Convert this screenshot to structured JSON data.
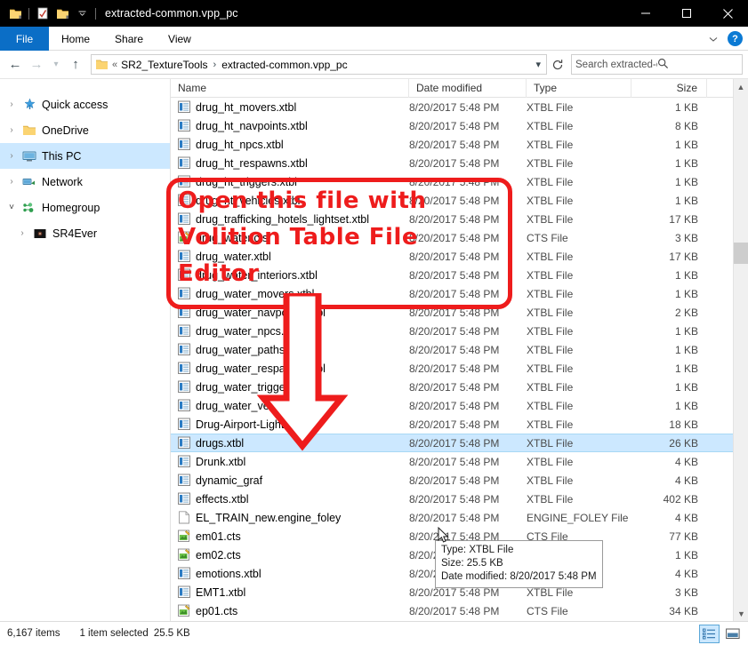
{
  "window": {
    "title": "extracted-common.vpp_pc",
    "quick_access_icons": [
      "folder-icon",
      "properties-icon",
      "new-folder-icon",
      "customize-chevron-icon"
    ],
    "controls": {
      "minimize": "minimize-icon",
      "maximize": "maximize-icon",
      "close": "close-icon"
    }
  },
  "ribbon": {
    "tabs": [
      {
        "label": "File",
        "active": true
      },
      {
        "label": "Home",
        "active": false
      },
      {
        "label": "Share",
        "active": false
      },
      {
        "label": "View",
        "active": false
      }
    ],
    "collapse_icon": "chevron-down-icon",
    "help_label": "?"
  },
  "address": {
    "back_icon": "back-arrow-icon",
    "forward_icon": "forward-arrow-icon",
    "recent_icon": "chevron-down-icon",
    "up_icon": "up-arrow-icon",
    "folder_icon": "folder-icon",
    "crumb_overflow": "«",
    "crumbs": [
      "SR2_TextureTools",
      "extracted-common.vpp_pc"
    ],
    "dropdown_icon": "chevron-down-icon",
    "refresh_icon": "refresh-icon",
    "search_placeholder": "Search extracted-common.v...",
    "search_value": "",
    "search_icon": "search-icon"
  },
  "navpane": {
    "items": [
      {
        "label": "Quick access",
        "icon": "star-pin-icon",
        "chevron": "›",
        "expanded": false,
        "selected": false,
        "indent": 0
      },
      {
        "label": "OneDrive",
        "icon": "onedrive-folder-icon",
        "chevron": "›",
        "expanded": false,
        "selected": false,
        "indent": 0
      },
      {
        "label": "This PC",
        "icon": "monitor-icon",
        "chevron": "›",
        "expanded": false,
        "selected": true,
        "indent": 0
      },
      {
        "label": "Network",
        "icon": "network-icon",
        "chevron": "›",
        "expanded": false,
        "selected": false,
        "indent": 0
      },
      {
        "label": "Homegroup",
        "icon": "homegroup-icon",
        "chevron": "˅",
        "expanded": true,
        "selected": false,
        "indent": 0
      },
      {
        "label": "SR4Ever",
        "icon": "computer-avatar-icon",
        "chevron": "›",
        "expanded": false,
        "selected": false,
        "indent": 1
      }
    ]
  },
  "filelist": {
    "columns": [
      "Name",
      "Date modified",
      "Type",
      "Size"
    ],
    "sort_indicator": "ascending-caret-icon",
    "rows": [
      {
        "name": "drug_ht_movers.xtbl",
        "date": "8/20/2017 5:48 PM",
        "type": "XTBL File",
        "size": "1 KB",
        "icon": "xtbl-file-icon",
        "selected": false
      },
      {
        "name": "drug_ht_navpoints.xtbl",
        "date": "8/20/2017 5:48 PM",
        "type": "XTBL File",
        "size": "8 KB",
        "icon": "xtbl-file-icon",
        "selected": false
      },
      {
        "name": "drug_ht_npcs.xtbl",
        "date": "8/20/2017 5:48 PM",
        "type": "XTBL File",
        "size": "1 KB",
        "icon": "xtbl-file-icon",
        "selected": false
      },
      {
        "name": "drug_ht_respawns.xtbl",
        "date": "8/20/2017 5:48 PM",
        "type": "XTBL File",
        "size": "1 KB",
        "icon": "xtbl-file-icon",
        "selected": false
      },
      {
        "name": "drug_ht_triggers.xtbl",
        "date": "8/20/2017 5:48 PM",
        "type": "XTBL File",
        "size": "1 KB",
        "icon": "xtbl-file-icon",
        "selected": false
      },
      {
        "name": "drug_ht_vehicles.xtbl",
        "date": "8/20/2017 5:48 PM",
        "type": "XTBL File",
        "size": "1 KB",
        "icon": "xtbl-file-icon",
        "selected": false
      },
      {
        "name": "drug_trafficking_hotels_lightset.xtbl",
        "date": "8/20/2017 5:48 PM",
        "type": "XTBL File",
        "size": "17 KB",
        "icon": "xtbl-file-icon",
        "selected": false
      },
      {
        "name": "drug_water.cts",
        "date": "8/20/2017 5:48 PM",
        "type": "CTS File",
        "size": "3 KB",
        "icon": "cts-file-icon",
        "selected": false
      },
      {
        "name": "drug_water.xtbl",
        "date": "8/20/2017 5:48 PM",
        "type": "XTBL File",
        "size": "17 KB",
        "icon": "xtbl-file-icon",
        "selected": false
      },
      {
        "name": "drug_water_interiors.xtbl",
        "date": "8/20/2017 5:48 PM",
        "type": "XTBL File",
        "size": "1 KB",
        "icon": "xtbl-file-icon",
        "selected": false
      },
      {
        "name": "drug_water_movers.xtbl",
        "date": "8/20/2017 5:48 PM",
        "type": "XTBL File",
        "size": "1 KB",
        "icon": "xtbl-file-icon",
        "selected": false
      },
      {
        "name": "drug_water_navpoints.xtbl",
        "date": "8/20/2017 5:48 PM",
        "type": "XTBL File",
        "size": "2 KB",
        "icon": "xtbl-file-icon",
        "selected": false
      },
      {
        "name": "drug_water_npcs.xtbl",
        "date": "8/20/2017 5:48 PM",
        "type": "XTBL File",
        "size": "1 KB",
        "icon": "xtbl-file-icon",
        "selected": false
      },
      {
        "name": "drug_water_paths.xtbl",
        "date": "8/20/2017 5:48 PM",
        "type": "XTBL File",
        "size": "1 KB",
        "icon": "xtbl-file-icon",
        "selected": false
      },
      {
        "name": "drug_water_respawns.xtbl",
        "date": "8/20/2017 5:48 PM",
        "type": "XTBL File",
        "size": "1 KB",
        "icon": "xtbl-file-icon",
        "selected": false
      },
      {
        "name": "drug_water_triggers.xtbl",
        "date": "8/20/2017 5:48 PM",
        "type": "XTBL File",
        "size": "1 KB",
        "icon": "xtbl-file-icon",
        "selected": false
      },
      {
        "name": "drug_water_vehicles.xtbl",
        "date": "8/20/2017 5:48 PM",
        "type": "XTBL File",
        "size": "1 KB",
        "icon": "xtbl-file-icon",
        "selected": false
      },
      {
        "name": "Drug-Airport-Lightset.xtbl",
        "date": "8/20/2017 5:48 PM",
        "type": "XTBL File",
        "size": "18 KB",
        "icon": "xtbl-file-icon",
        "selected": false
      },
      {
        "name": "drugs.xtbl",
        "date": "8/20/2017 5:48 PM",
        "type": "XTBL File",
        "size": "26 KB",
        "icon": "xtbl-file-icon",
        "selected": true
      },
      {
        "name": "Drunk.xtbl",
        "date": "8/20/2017 5:48 PM",
        "type": "XTBL File",
        "size": "4 KB",
        "icon": "xtbl-file-icon",
        "selected": false
      },
      {
        "name": "dynamic_graf",
        "date": "8/20/2017 5:48 PM",
        "type": "XTBL File",
        "size": "4 KB",
        "icon": "xtbl-file-icon",
        "selected": false
      },
      {
        "name": "effects.xtbl",
        "date": "8/20/2017 5:48 PM",
        "type": "XTBL File",
        "size": "402 KB",
        "icon": "xtbl-file-icon",
        "selected": false
      },
      {
        "name": "EL_TRAIN_new.engine_foley",
        "date": "8/20/2017 5:48 PM",
        "type": "ENGINE_FOLEY File",
        "size": "4 KB",
        "icon": "blank-file-icon",
        "selected": false
      },
      {
        "name": "em01.cts",
        "date": "8/20/2017 5:48 PM",
        "type": "CTS File",
        "size": "77 KB",
        "icon": "cts-file-icon",
        "selected": false
      },
      {
        "name": "em02.cts",
        "date": "8/20/2017 5:48 PM",
        "type": "CTS File",
        "size": "1 KB",
        "icon": "cts-file-icon",
        "selected": false
      },
      {
        "name": "emotions.xtbl",
        "date": "8/20/2017 5:48 PM",
        "type": "XTBL File",
        "size": "4 KB",
        "icon": "xtbl-file-icon",
        "selected": false
      },
      {
        "name": "EMT1.xtbl",
        "date": "8/20/2017 5:48 PM",
        "type": "XTBL File",
        "size": "3 KB",
        "icon": "xtbl-file-icon",
        "selected": false
      },
      {
        "name": "ep01.cts",
        "date": "8/20/2017 5:48 PM",
        "type": "CTS File",
        "size": "34 KB",
        "icon": "cts-file-icon",
        "selected": false
      }
    ]
  },
  "tooltip": {
    "line1": "Type: XTBL File",
    "line2": "Size: 25.5 KB",
    "line3": "Date modified: 8/20/2017 5:48 PM"
  },
  "annotation": {
    "color": "#ee1c1c",
    "line1": "Open this file with",
    "line2": "Volition Table  File",
    "line3": "Editor",
    "arrow": "down-arrow-annotation"
  },
  "statusbar": {
    "item_count": "6,167 items",
    "selection": "1 item selected",
    "selection_size": "25.5 KB",
    "view_details_icon": "details-view-icon",
    "view_large_icon": "large-icons-view-icon"
  }
}
